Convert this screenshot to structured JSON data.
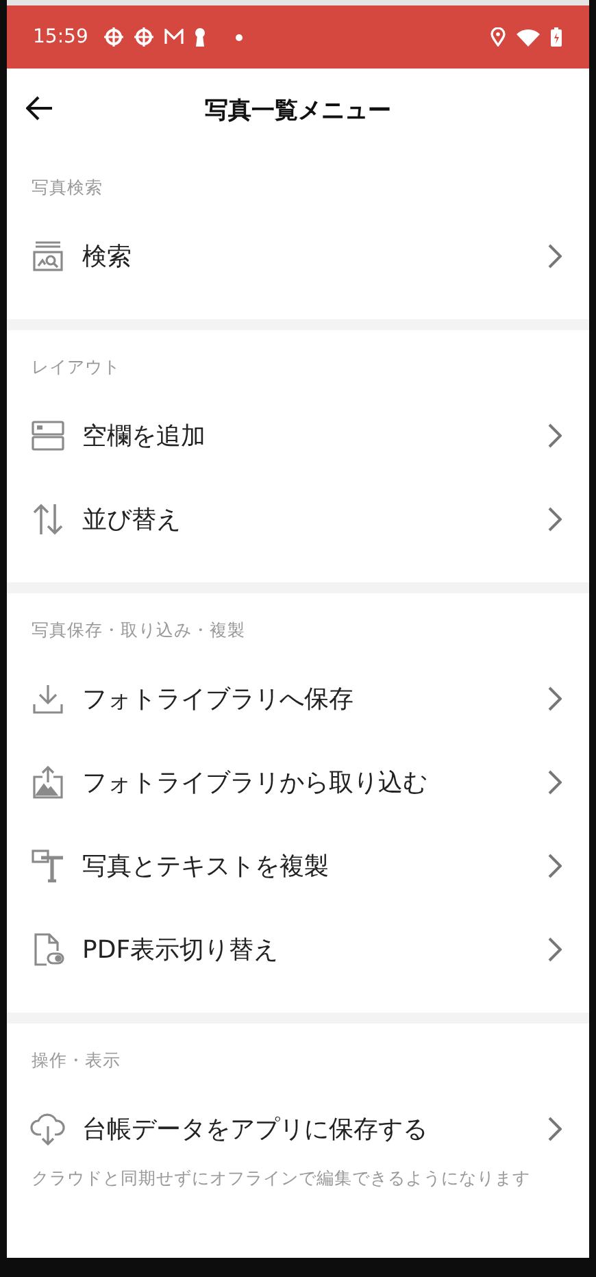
{
  "status_bar": {
    "time": "15:59"
  },
  "header": {
    "title": "写真一覧メニュー"
  },
  "sections": [
    {
      "heading": "写真検索",
      "items": [
        {
          "label": "検索"
        }
      ]
    },
    {
      "heading": "レイアウト",
      "items": [
        {
          "label": "空欄を追加"
        },
        {
          "label": "並び替え"
        }
      ]
    },
    {
      "heading": "写真保存・取り込み・複製",
      "items": [
        {
          "label": "フォトライブラリへ保存"
        },
        {
          "label": "フォトライブラリから取り込む"
        },
        {
          "label": "写真とテキストを複製"
        },
        {
          "label": "PDF表示切り替え"
        }
      ]
    },
    {
      "heading": "操作・表示",
      "items": [
        {
          "label": "台帳データをアプリに保存する"
        }
      ],
      "note": "クラウドと同期せずにオフラインで編集できるようになります"
    }
  ]
}
